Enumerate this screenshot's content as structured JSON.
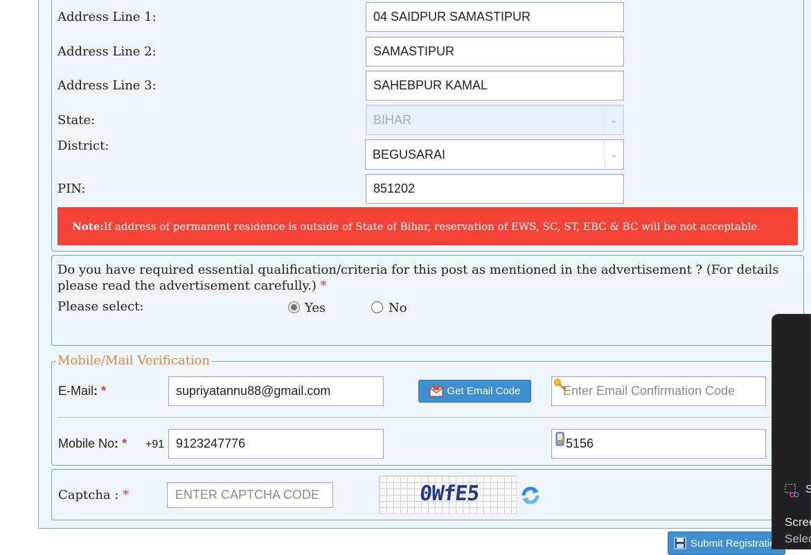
{
  "address": {
    "line1_label": "Address Line 1:",
    "line1_value": "04 SAIDPUR SAMASTIPUR",
    "line2_label": "Address Line 2:",
    "line2_value": "SAMASTIPUR",
    "line3_label": "Address Line 3:",
    "line3_value": "SAHEBPUR KAMAL",
    "state_label": "State:",
    "state_value": "BIHAR",
    "district_label": "District:",
    "district_value": "BEGUSARAI",
    "pin_label": "PIN:",
    "pin_value": "851202"
  },
  "note": {
    "prefix": "Note:",
    "text": " If address of permanent residence is outside of State of Bihar, reservation of EWS, SC, ST, EBC & BC will be not acceptable."
  },
  "qualification": {
    "question": "Do you have required essential qualification/criteria for this post as mentioned in the advertisement ? (For details please read the advertisement carefully.)",
    "required_mark": "*",
    "select_label": "Please select:",
    "yes_label": "Yes",
    "no_label": "No",
    "selected": "Yes"
  },
  "verification": {
    "legend": "Mobile/Mail Verification",
    "email_label": "E-Mail",
    "colon": ":",
    "required_mark": "*",
    "email_value": "supriyatannu88@gmail.com",
    "get_email_code": "Get Email Code",
    "email_code_placeholder": "Enter Email Confirmation Code",
    "mobile_label": "Mobile No",
    "country_code": "+91",
    "mobile_value": "9123247776",
    "mobile_code_value": "5156"
  },
  "captcha": {
    "label": "Captcha :",
    "required_mark": "*",
    "placeholder": "ENTER CAPTCHA CODE",
    "image_text": "0WfE5"
  },
  "submit": {
    "label": "Submit Registration"
  },
  "overlay": {
    "line1": "S",
    "line2": "Scree",
    "line3": "Selec"
  }
}
